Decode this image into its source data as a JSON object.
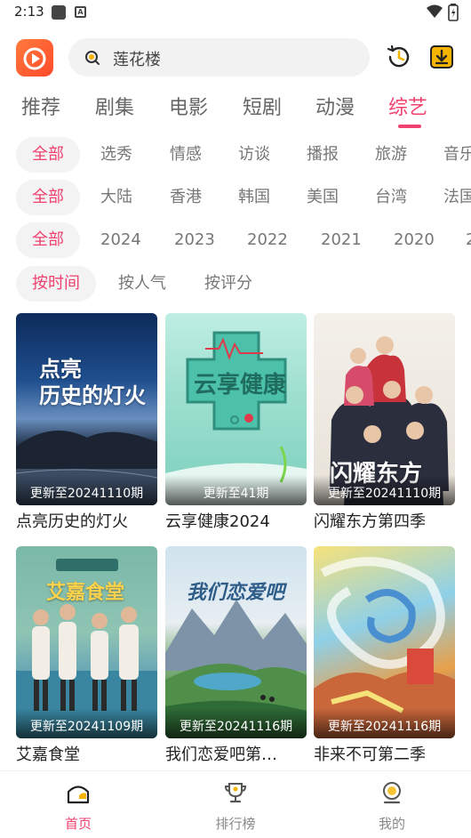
{
  "status_bar": {
    "time": "2:13"
  },
  "search": {
    "placeholder": "莲花楼"
  },
  "categories": [
    {
      "label": "推荐"
    },
    {
      "label": "剧集"
    },
    {
      "label": "电影"
    },
    {
      "label": "短剧"
    },
    {
      "label": "动漫"
    },
    {
      "label": "综艺"
    }
  ],
  "active_category": "综艺",
  "filters": {
    "type": [
      "全部",
      "选秀",
      "情感",
      "访谈",
      "播报",
      "旅游",
      "音乐"
    ],
    "region": [
      "全部",
      "大陆",
      "香港",
      "韩国",
      "美国",
      "台湾",
      "法国"
    ],
    "year": [
      "全部",
      "2024",
      "2023",
      "2022",
      "2021",
      "2020",
      "2"
    ],
    "sort": [
      "按时间",
      "按人气",
      "按评分"
    ]
  },
  "cards": [
    {
      "title": "点亮历史的灯火",
      "update": "更新至20241110期",
      "poster_text": "点亮\n历史的灯火"
    },
    {
      "title": "云享健康2024",
      "update": "更新至41期",
      "poster_text": "云享健康"
    },
    {
      "title": "闪耀东方第四季",
      "update": "更新至20241110期",
      "poster_text": "闪耀东方"
    },
    {
      "title": "艾嘉食堂",
      "update": "更新至20241109期",
      "poster_text": "艾嘉食堂"
    },
    {
      "title": "我们恋爱吧第…",
      "update": "更新至20241116期",
      "poster_text": "我们恋爱吧"
    },
    {
      "title": "非来不可第二季",
      "update": "更新至20241116期",
      "poster_text": ""
    }
  ],
  "bottom_nav": [
    {
      "label": "首页",
      "icon": "home-icon"
    },
    {
      "label": "排行榜",
      "icon": "trophy-icon"
    },
    {
      "label": "我的",
      "icon": "profile-icon"
    }
  ],
  "colors": {
    "accent": "#f0416f",
    "logo": "#ff5a2d"
  }
}
